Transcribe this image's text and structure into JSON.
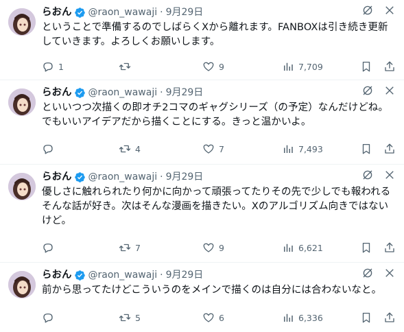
{
  "tweets": [
    {
      "name": "らおん",
      "handle": "@raon_wawaji",
      "separator": "·",
      "date": "9月29日",
      "text": "ということで準備するのでしばらくXから離れます。FANBOXは引き続き更新していきます。よろしくお願いします。",
      "replies": "1",
      "retweets": "",
      "likes": "9",
      "views": "7,709"
    },
    {
      "name": "らおん",
      "handle": "@raon_wawaji",
      "separator": "·",
      "date": "9月29日",
      "text": "といいつつ次描くの即オチ2コマのギャグシリーズ（の予定）なんだけどね。 でもいいアイデアだから描くことにする。きっと温かいよ。",
      "replies": "",
      "retweets": "4",
      "likes": "7",
      "views": "7,493"
    },
    {
      "name": "らおん",
      "handle": "@raon_wawaji",
      "separator": "·",
      "date": "9月29日",
      "text": "優しさに触れられたり何かに向かって頑張ってたりその先で少しでも報われるそんな話が好き。次はそんな漫画を描きたい。Xのアルゴリズム向きではないけど。",
      "replies": "",
      "retweets": "7",
      "likes": "9",
      "views": "6,621"
    },
    {
      "name": "らおん",
      "handle": "@raon_wawaji",
      "separator": "·",
      "date": "9月29日",
      "text": "前から思ってたけどこういうのをメインで描くのは自分には合わないなと。",
      "replies": "",
      "retweets": "5",
      "likes": "6",
      "views": "6,336"
    }
  ],
  "icons": {
    "verified": "verified-badge-icon",
    "grok": "grok-icon",
    "more": "more-icon",
    "reply": "reply-icon",
    "retweet": "retweet-icon",
    "like": "like-icon",
    "views": "views-icon",
    "bookmark": "bookmark-icon",
    "share": "share-icon"
  },
  "colors": {
    "verified": "#1d9bf0",
    "text": "#0f1419",
    "muted": "#536471",
    "divider": "#eff3f4"
  }
}
